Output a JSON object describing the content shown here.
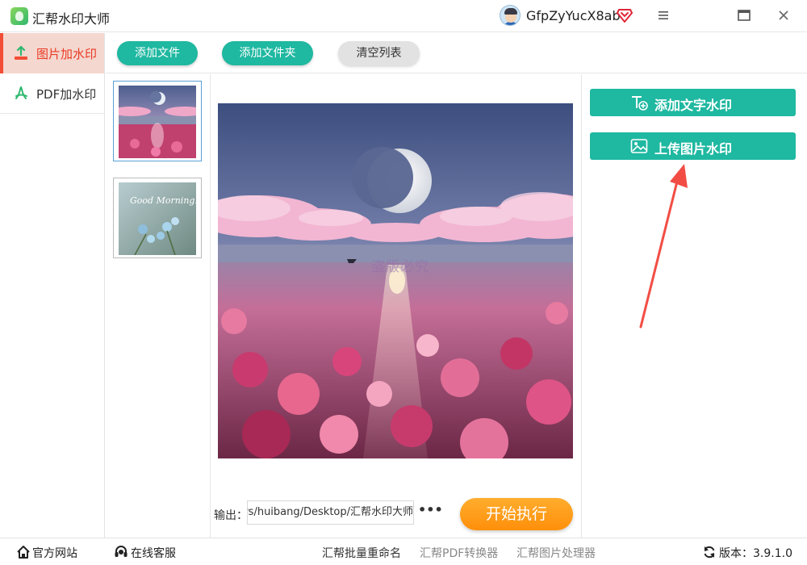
{
  "app": {
    "title": "汇帮水印大师",
    "username": "GfpZyYucX8ab"
  },
  "colors": {
    "accent": "#1fb8a1",
    "active_red": "#ea3b24",
    "start_orange": "#ff9a1a",
    "arrow_red": "#f24d45"
  },
  "titlebar": {
    "icons": [
      "avatar",
      "vip-diamond-icon",
      "menu-icon",
      "maximize-icon",
      "close-icon"
    ]
  },
  "sidebar": {
    "items": [
      {
        "label": "图片加水印",
        "icon": "image-upload-icon",
        "active": true
      },
      {
        "label": "PDF加水印",
        "icon": "pdf-icon",
        "active": false
      }
    ]
  },
  "toolbar": {
    "add_file": "添加文件",
    "add_folder": "添加文件夹",
    "clear_list": "清空列表"
  },
  "thumbnails": [
    {
      "description": "moon-flower-sea",
      "selected": true
    },
    {
      "description": "good-morning-flowers",
      "selected": false,
      "text": "Good Morning!"
    }
  ],
  "preview": {
    "watermark_text": "盗版必究"
  },
  "output": {
    "label": "输出：",
    "path": "C:/Users/huibang/Desktop/汇帮水印大师",
    "more": "•••",
    "start_button": "开始执行"
  },
  "right_panel": {
    "add_text_watermark": "添加文字水印",
    "upload_image_watermark": "上传图片水印"
  },
  "bottombar": {
    "website": "官方网站",
    "service": "在线客服",
    "rename_tool": "汇帮批量重命名",
    "pdf_tool": "汇帮PDF转换器",
    "image_tool": "汇帮图片处理器",
    "version_label": "版本：",
    "version": "3.9.1.0"
  }
}
